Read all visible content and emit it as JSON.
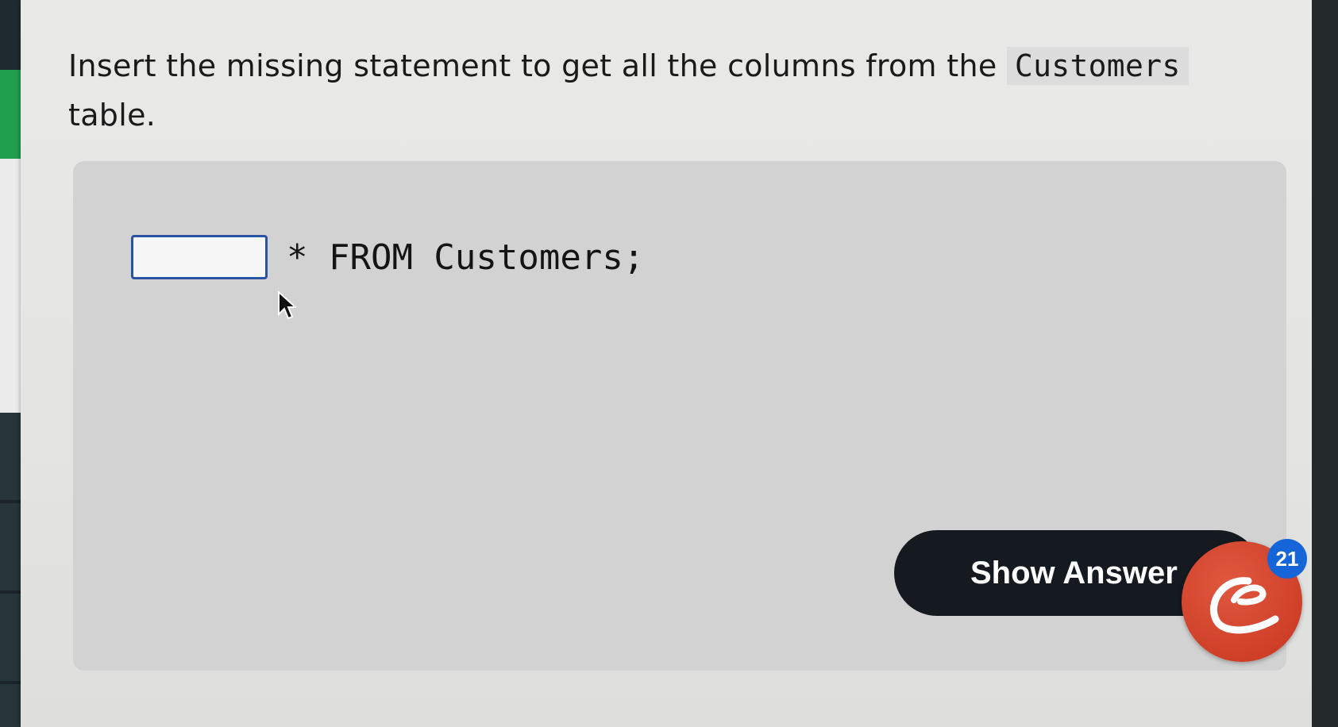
{
  "question": {
    "text_before": "Insert the missing statement to get all the columns from the",
    "inline_code": "Customers",
    "text_after": "table."
  },
  "exercise": {
    "input_value": "",
    "code_after_input": "* FROM Customers;"
  },
  "show_answer_label": "Show Answer",
  "notification_count": "21",
  "colors": {
    "input_border": "#2b53a3",
    "button_bg": "#141a20",
    "logo_red": "#c8351f",
    "badge_blue": "#1565d8",
    "rail_green": "#1f9f4e"
  },
  "icons": {
    "logo": "curly-c-logo-icon",
    "pointer": "mouse-pointer-icon"
  }
}
